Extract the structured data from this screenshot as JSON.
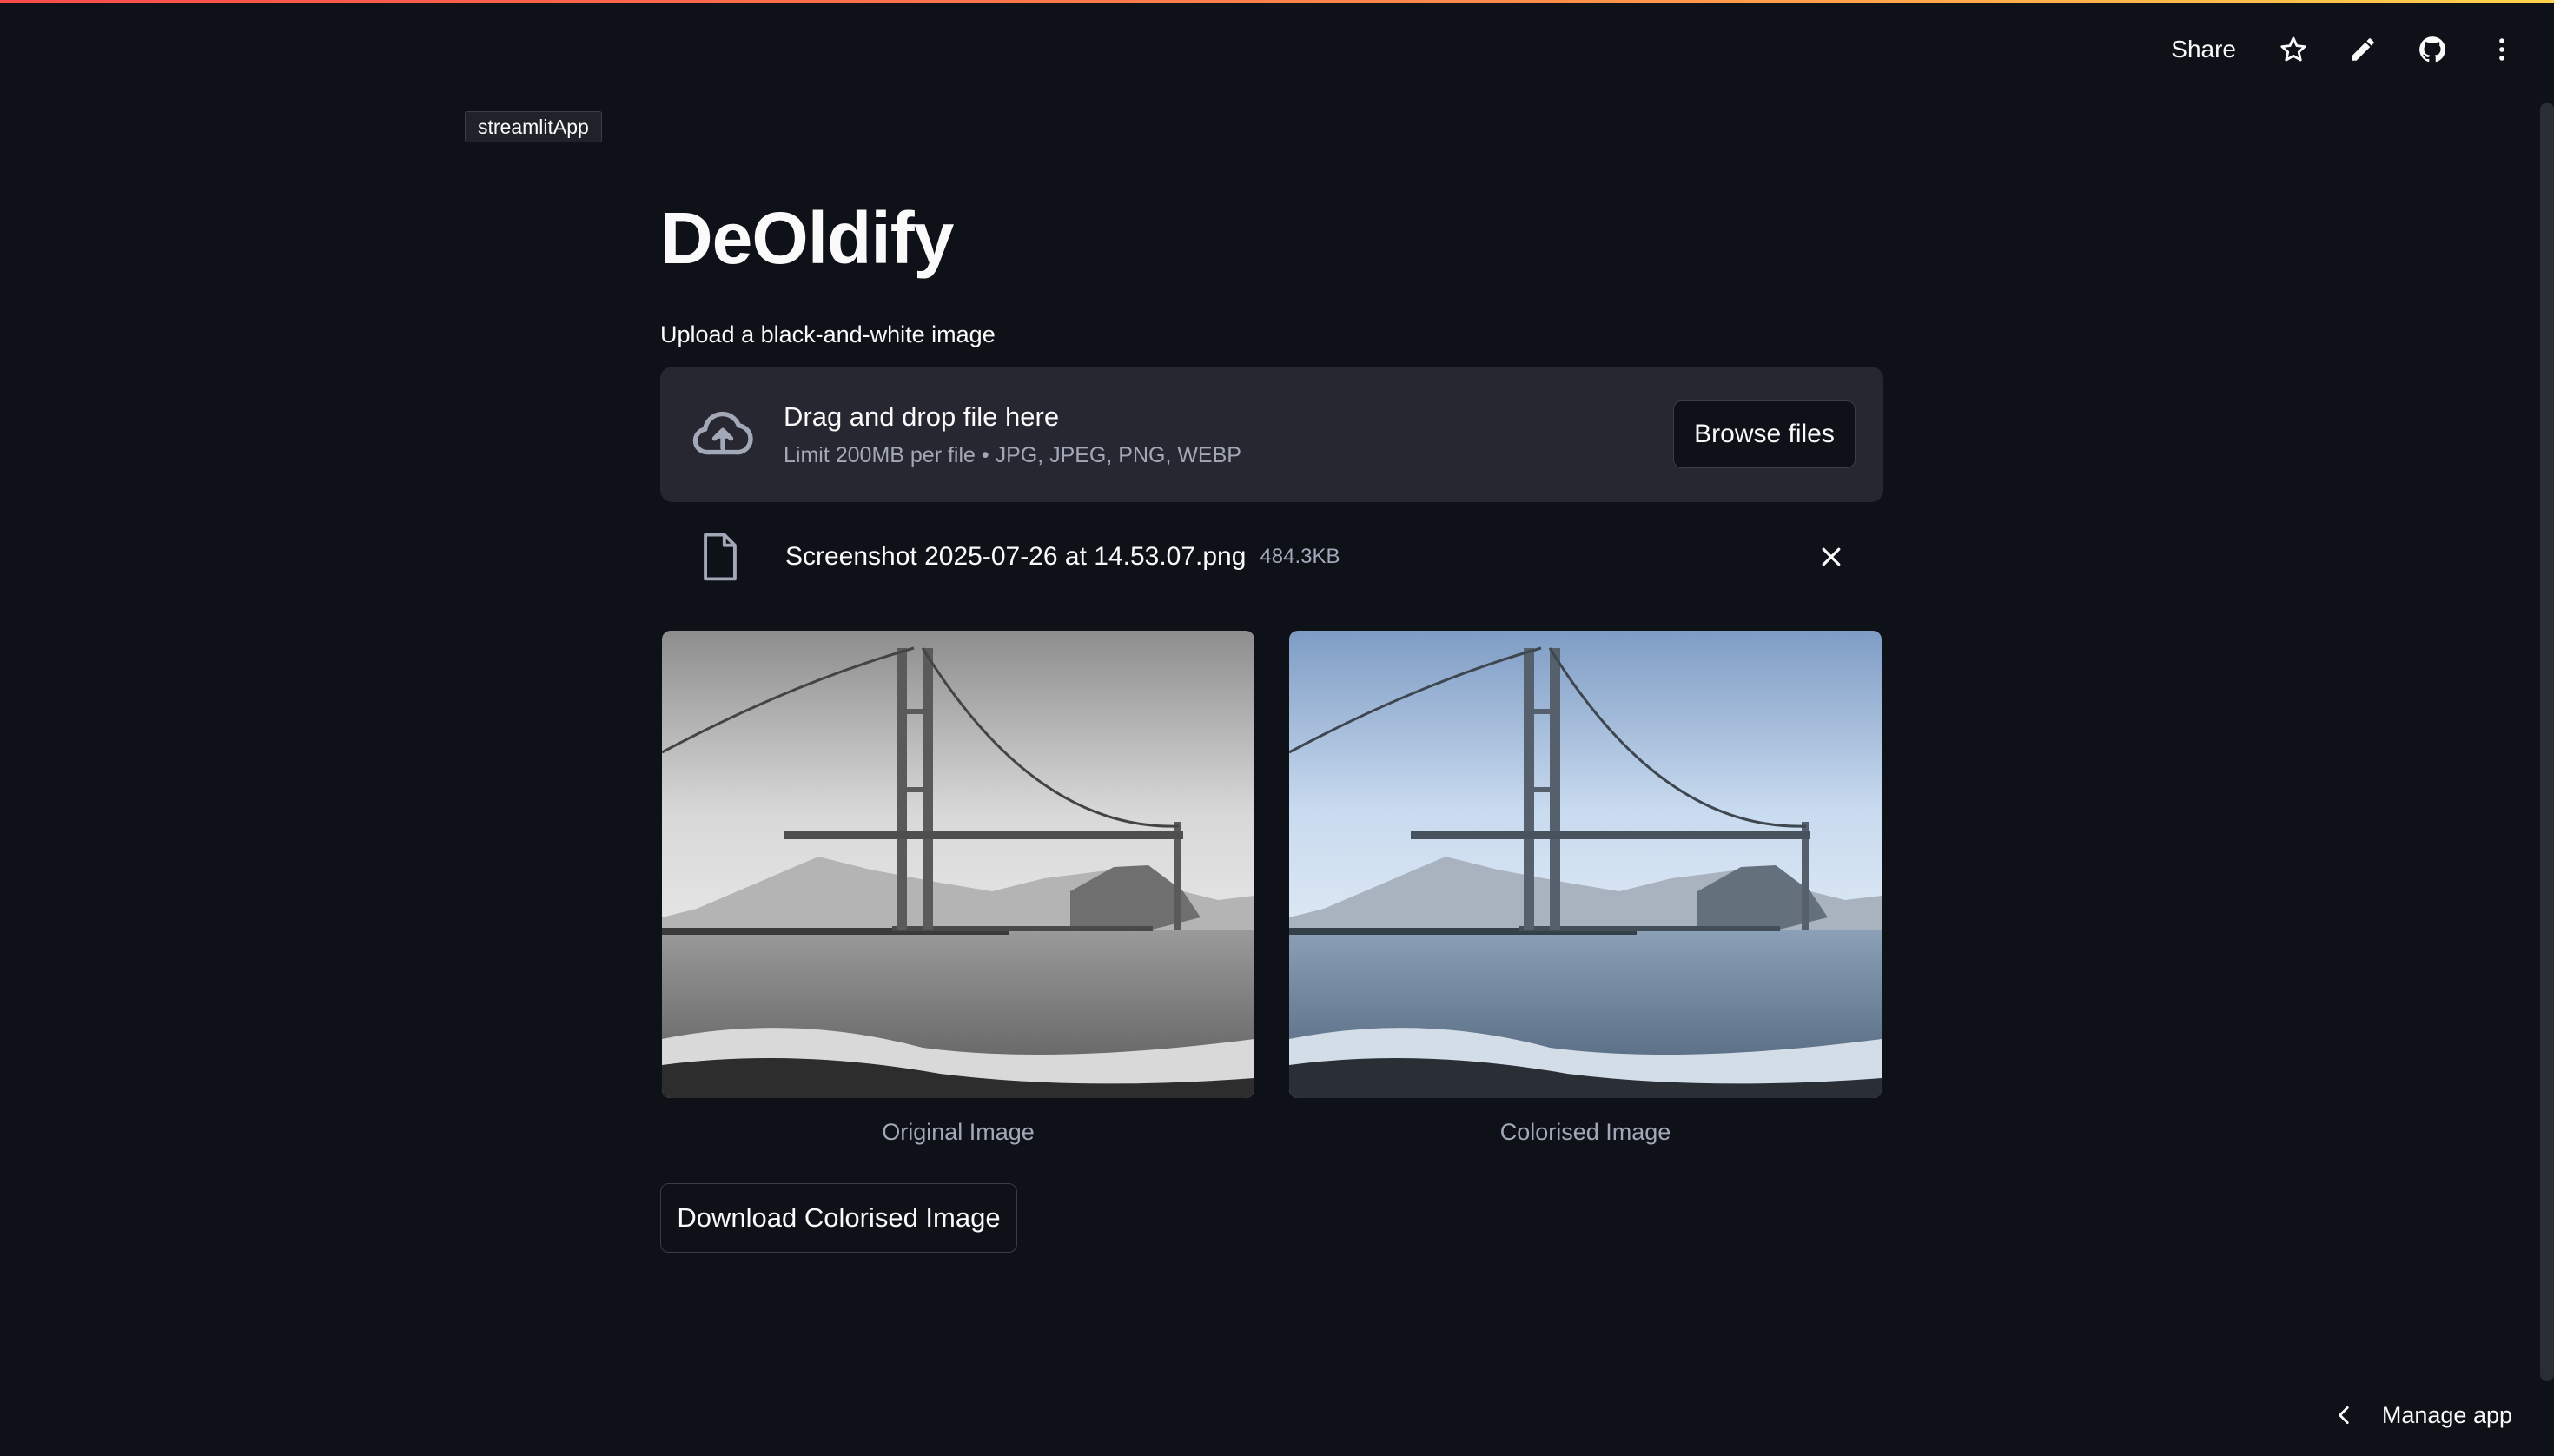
{
  "header": {
    "share_label": "Share",
    "icons": [
      "star-icon",
      "pencil-icon",
      "github-icon",
      "kebab-menu-icon"
    ]
  },
  "tooltip": {
    "text": "streamlitApp"
  },
  "page": {
    "title": "DeOldify",
    "upload_label": "Upload a black-and-white image"
  },
  "uploader": {
    "title": "Drag and drop file here",
    "subtitle": "Limit 200MB per file • JPG, JPEG, PNG, WEBP",
    "browse_label": "Browse files",
    "icon": "cloud-upload-icon"
  },
  "file": {
    "name": "Screenshot 2025-07-26 at 14.53.07.png",
    "size": "484.3KB"
  },
  "images": [
    {
      "caption": "Original Image"
    },
    {
      "caption": "Colorised Image"
    }
  ],
  "download_label": "Download Colorised Image",
  "footer": {
    "manage_label": "Manage app"
  },
  "colors": {
    "background": "#0e1117",
    "panel": "#262730",
    "accent": "#ff4b4b"
  }
}
